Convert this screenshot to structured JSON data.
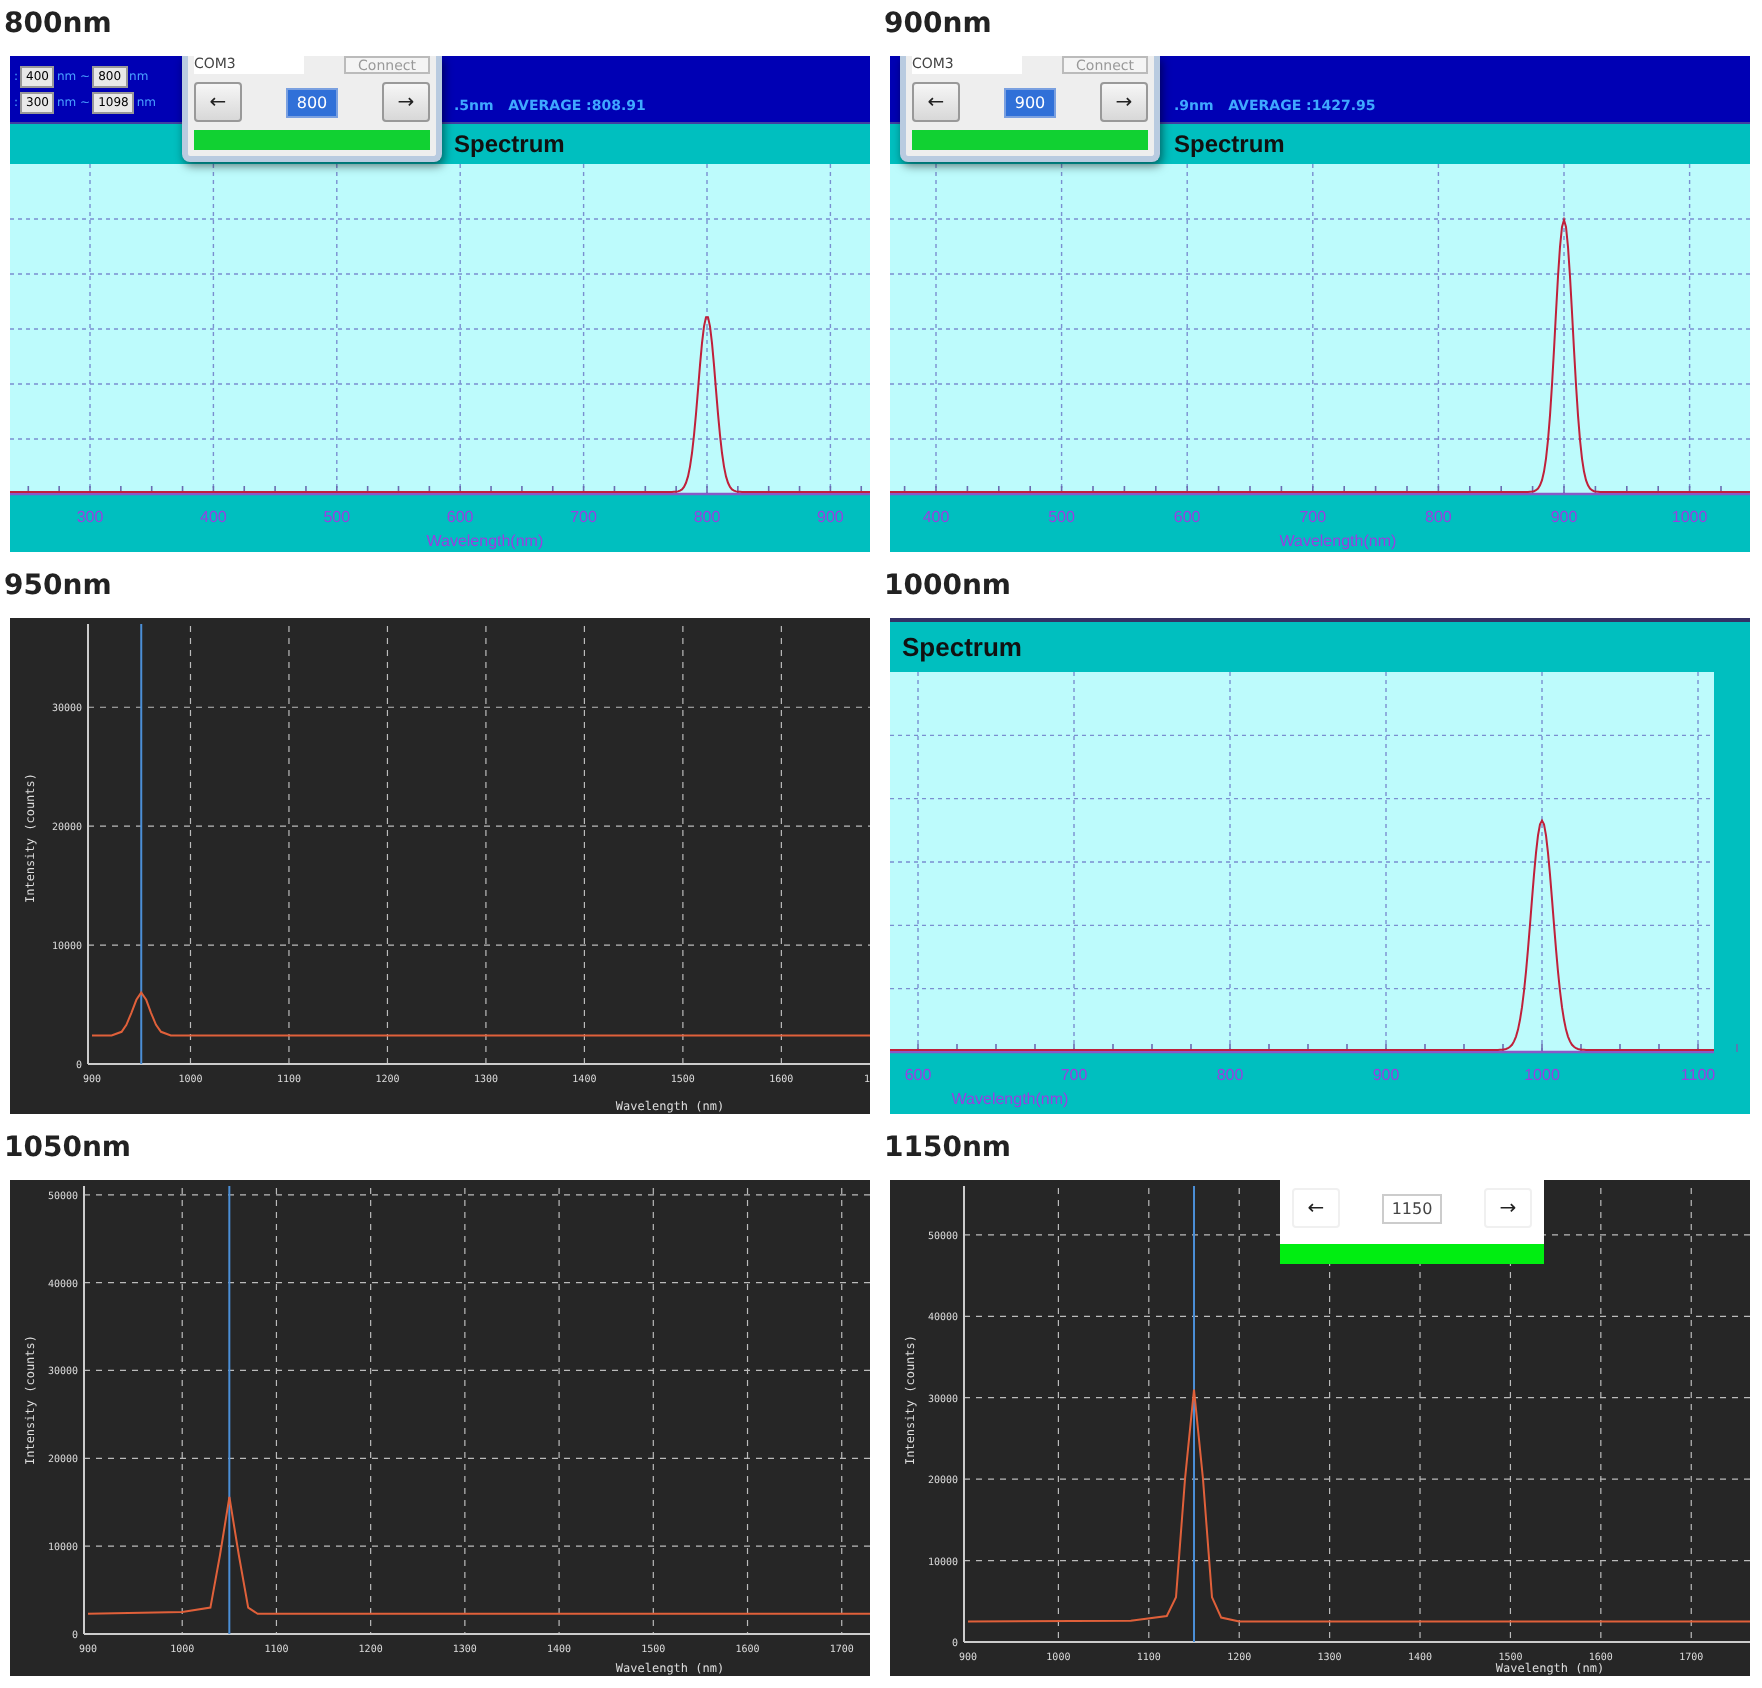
{
  "panels": [
    {
      "caption": "800nm",
      "kind": "cyan_app",
      "range_rows": [
        {
          "sep": ":",
          "from": "400",
          "unit_from": "nm ~",
          "to": "800",
          "unit_to": "nm"
        },
        {
          "sep": ":",
          "from": "300",
          "unit_from": "nm ~",
          "to": "1098",
          "unit_to": "nm"
        }
      ],
      "status_text": ".5nm   AVERAGE :808.91",
      "dialog": {
        "port": "COM3",
        "connect": "Connect",
        "back": "←",
        "value": "800",
        "value_selected": true,
        "forward": "→",
        "progress": {
          "level": 1
        }
      },
      "title": "Spectrum",
      "x_ticks": [
        "300",
        "400",
        "500",
        "600",
        "700",
        "800",
        "900"
      ],
      "x_label": "Wavelength(nm)"
    },
    {
      "caption": "900nm",
      "kind": "cyan_app",
      "status_text": ".9nm   AVERAGE :1427.95",
      "dialog": {
        "port": "COM3",
        "connect": "Connect",
        "back": "←",
        "value": "900",
        "value_selected": true,
        "forward": "→",
        "progress": {
          "level": 1
        }
      },
      "title": "Spectrum",
      "x_ticks": [
        "400",
        "500",
        "600",
        "700",
        "800",
        "900",
        "1000"
      ],
      "x_label": "Wavelength(nm)"
    },
    {
      "caption": "950nm",
      "kind": "dark_plot",
      "x_edge_label": "1",
      "chart_data": {
        "type": "line",
        "grid": true,
        "xlim": [
          900,
          1690
        ],
        "ylim": [
          0,
          37000
        ],
        "ref_lines": [
          {
            "axis": "x",
            "value": 950
          }
        ],
        "xlabel": "Wavelength (nm)",
        "ylabel": "Intensity (counts)",
        "xticks": [
          900,
          1000,
          1100,
          1200,
          1300,
          1400,
          1500,
          1600
        ],
        "yticks": [
          30000,
          20000,
          10000,
          0
        ],
        "x": [
          900,
          920,
          930,
          935,
          940,
          945,
          950,
          955,
          960,
          965,
          970,
          980,
          1000,
          1690
        ],
        "series": [
          {
            "color": "#e0603a",
            "values": [
              2400,
              2400,
              2700,
              3300,
              4300,
              5400,
              6000,
              5400,
              4300,
              3300,
              2700,
              2400,
              2400,
              2400
            ]
          }
        ]
      }
    },
    {
      "caption": "1000nm",
      "kind": "cyan_app",
      "title": "Spectrum",
      "x_ticks": [
        "600",
        "700",
        "800",
        "900",
        "1000",
        "1100"
      ],
      "x_label": "Wavelength(nm)"
    },
    {
      "caption": "1050nm",
      "kind": "dark_plot",
      "chart_data": {
        "type": "line",
        "grid": true,
        "xlim": [
          900,
          1730
        ],
        "ylim": [
          0,
          51000
        ],
        "ref_lines": [
          {
            "axis": "x",
            "value": 1050
          }
        ],
        "xlabel": "Wavelength (nm)",
        "ylabel": "Intensity (counts)",
        "xticks": [
          900,
          1000,
          1100,
          1200,
          1300,
          1400,
          1500,
          1600,
          1700
        ],
        "yticks": [
          50000,
          40000,
          30000,
          20000,
          10000,
          0
        ],
        "x": [
          900,
          1000,
          1030,
          1040,
          1050,
          1060,
          1070,
          1080,
          1100,
          1730
        ],
        "series": [
          {
            "color": "#e0603a",
            "values": [
              2300,
              2500,
              3000,
              9000,
              15600,
              9000,
              3000,
              2300,
              2300,
              2300
            ]
          }
        ]
      }
    },
    {
      "caption": "1150nm",
      "kind": "dark_plot",
      "dialog": {
        "back": "←",
        "value": "1150",
        "value_selected": false,
        "forward": "→",
        "progress": {
          "level": 1
        }
      },
      "chart_data": {
        "type": "line",
        "grid": true,
        "xlim": [
          900,
          1765
        ],
        "ylim": [
          0,
          56000
        ],
        "ref_lines": [
          {
            "axis": "x",
            "value": 1150
          }
        ],
        "xlabel": "Wavelength (nm)",
        "ylabel": "Intensity (counts)",
        "xticks": [
          900,
          1000,
          1100,
          1200,
          1300,
          1400,
          1500,
          1600,
          1700
        ],
        "yticks": [
          50000,
          40000,
          30000,
          20000,
          10000,
          0
        ],
        "x": [
          900,
          1080,
          1120,
          1130,
          1140,
          1150,
          1160,
          1170,
          1180,
          1200,
          1765
        ],
        "series": [
          {
            "color": "#e0603a",
            "values": [
              2500,
              2600,
              3200,
              5500,
              20000,
              31000,
              20000,
              5500,
              3000,
              2500,
              2500
            ]
          }
        ]
      }
    }
  ]
}
